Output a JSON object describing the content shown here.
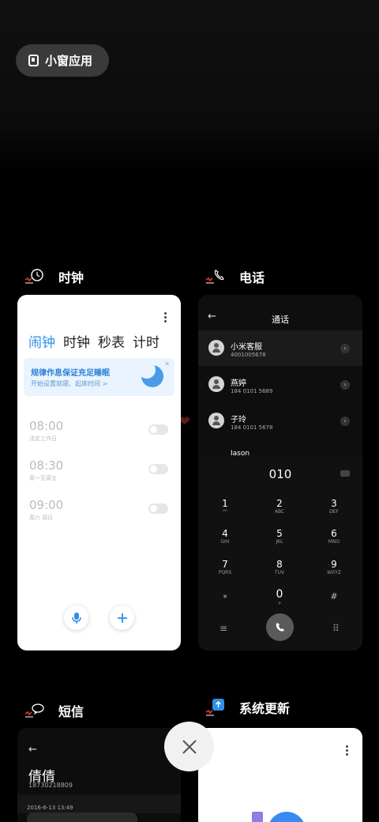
{
  "mini_window_button": {
    "label": "小窗应用"
  },
  "apps": {
    "clock": {
      "title": "时钟",
      "tabs": [
        "闹钟",
        "时钟",
        "秒表",
        "计时"
      ],
      "banner": {
        "title": "规律作息保证充足睡眠",
        "subtitle": "开始设置就寝、起床时间 >"
      },
      "alarms": [
        {
          "time": "08:00",
          "repeat": "法定工作日"
        },
        {
          "time": "08:30",
          "repeat": "周一至周五"
        },
        {
          "time": "09:00",
          "repeat": "周六 周日"
        }
      ]
    },
    "phone": {
      "title": "电话",
      "header": "通话",
      "contacts": [
        {
          "name": "小米客服",
          "number": "4001005678"
        },
        {
          "name": "燕婷",
          "number": "184 0101 5689"
        },
        {
          "name": "子玲",
          "number": "184 0101 5678"
        }
      ],
      "partial_contact": "Jason",
      "dial_display": "010",
      "keys": [
        {
          "digit": "1",
          "letters": "ᴼᴼ"
        },
        {
          "digit": "2",
          "letters": "ABC"
        },
        {
          "digit": "3",
          "letters": "DEF"
        },
        {
          "digit": "4",
          "letters": "GHI"
        },
        {
          "digit": "5",
          "letters": "JKL"
        },
        {
          "digit": "6",
          "letters": "MNO"
        },
        {
          "digit": "7",
          "letters": "PQRS"
        },
        {
          "digit": "8",
          "letters": "TUV"
        },
        {
          "digit": "9",
          "letters": "WXYZ"
        },
        {
          "digit": "*",
          "letters": ""
        },
        {
          "digit": "0",
          "letters": "+"
        },
        {
          "digit": "#",
          "letters": ""
        }
      ]
    },
    "sms": {
      "title": "短信",
      "contact_name": "倩倩",
      "contact_number": "18730218809",
      "date": "2016-6-13 13:49"
    },
    "update": {
      "title": "系统更新"
    }
  },
  "colors": {
    "accent_blue": "#2f8fe6",
    "background": "#000000",
    "pill": "#3a3a3a"
  },
  "icons": {
    "close": "close-icon",
    "call": "phone-call-icon",
    "mic": "microphone-icon",
    "add": "plus-icon"
  }
}
